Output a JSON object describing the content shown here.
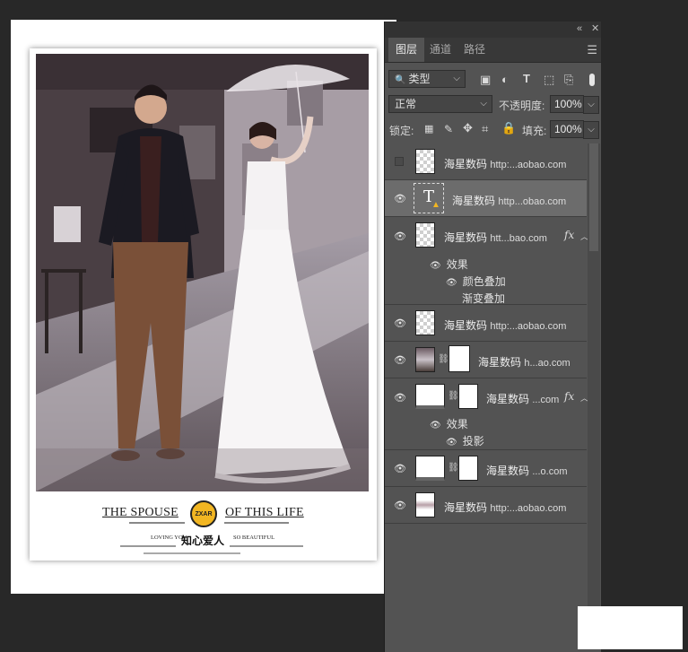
{
  "panel": {
    "tabs": [
      {
        "label": "图层"
      },
      {
        "label": "通道"
      },
      {
        "label": "路径"
      }
    ],
    "topbar": {
      "collapse": "«",
      "close": "✕"
    },
    "menu_icon": "hamburger-icon",
    "filter": {
      "label": "类型"
    },
    "blend_mode": {
      "label": "正常"
    },
    "opacity": {
      "label": "不透明度:",
      "value": "100%"
    },
    "lock": {
      "label": "锁定:"
    },
    "fill": {
      "label": "填充:",
      "value": "100%"
    }
  },
  "layers": [
    {
      "name": "海星数码",
      "sub": "http:...aobao.com",
      "visible": false,
      "thumb": "transparent"
    },
    {
      "name": "海星数码",
      "sub": "http...obao.com",
      "visible": true,
      "thumb": "text",
      "selected": true
    },
    {
      "name": "海星数码",
      "sub": "htt...bao.com",
      "visible": true,
      "thumb": "transparent",
      "fx": "fx",
      "effects_label": "效果",
      "effects": [
        "颜色叠加",
        "渐变叠加"
      ]
    },
    {
      "name": "海星数码",
      "sub": "http:...aobao.com",
      "visible": true,
      "thumb": "transparent"
    },
    {
      "name": "海星数码",
      "sub": "h...ao.com",
      "visible": true,
      "thumb": "photo-mask"
    },
    {
      "name": "海星数码",
      "sub": "...com",
      "visible": true,
      "thumb": "white-mask",
      "fx": "fx",
      "effects_label": "效果",
      "effects": [
        "投影"
      ]
    },
    {
      "name": "海星数码",
      "sub": "...o.com",
      "visible": true,
      "thumb": "white-mask"
    },
    {
      "name": "海星数码",
      "sub": "http:...aobao.com",
      "visible": true,
      "thumb": "mini-doc"
    }
  ],
  "document": {
    "caption": {
      "left_title": "THE SPOUSE",
      "right_title": "OF THIS LIFE",
      "badge": "ZXAR",
      "chinese_title": "知心爱人",
      "loving_you": "LOVING YOU",
      "so_beautiful": "SO BEAUTIFUL"
    }
  },
  "colors": {
    "panel_bg": "#535353",
    "selected_layer": "#6c6c6c",
    "badge": "#f2b622"
  }
}
